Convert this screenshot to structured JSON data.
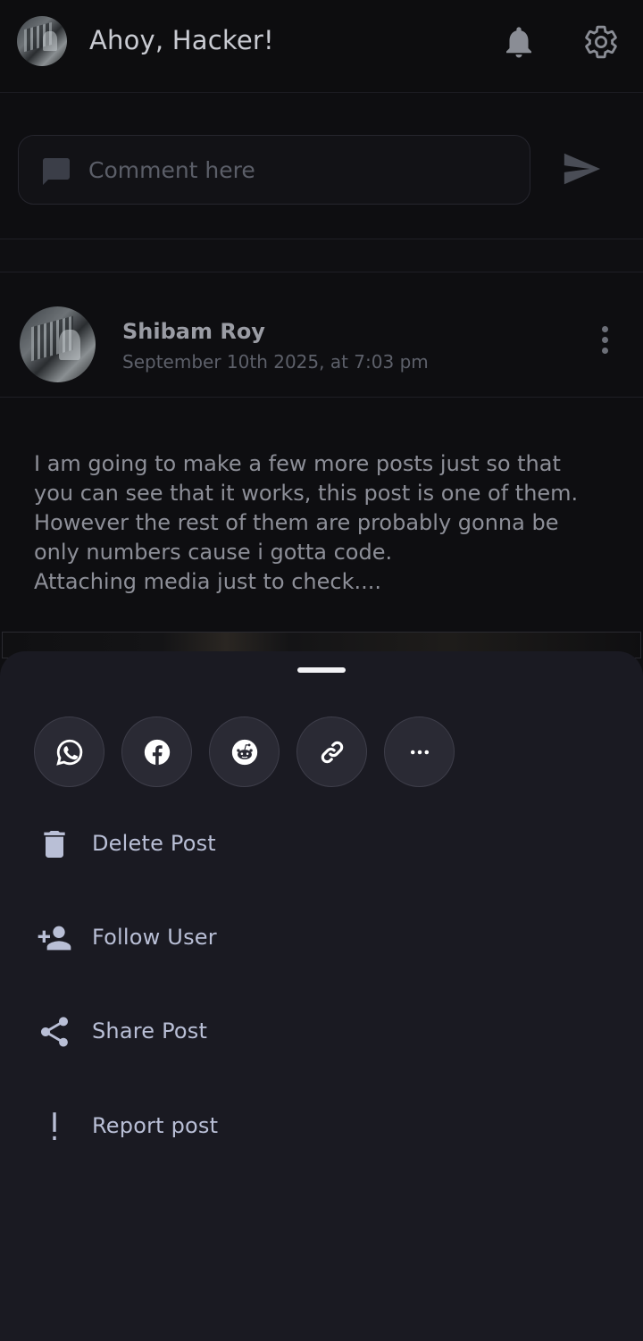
{
  "header": {
    "greeting": "Ahoy, Hacker!",
    "icons": [
      "profile-avatar",
      "bell-icon",
      "gear-icon"
    ]
  },
  "comment": {
    "placeholder": "Comment here",
    "icons": [
      "chat-bubble-icon",
      "send-icon"
    ]
  },
  "post": {
    "author": "Shibam Roy",
    "date": "September 10th 2025, at 7:03 pm",
    "body_lines": [
      "I am going to make a few more posts just so that",
      "you can see that it works, this post is one of them.",
      "However the rest of them are probably gonna be",
      "only numbers cause i gotta code.",
      "Attaching media just to check...."
    ]
  },
  "sheet": {
    "share_buttons": [
      "whatsapp-icon",
      "facebook-icon",
      "reddit-icon",
      "link-icon",
      "more-icon"
    ],
    "menu": [
      {
        "label": "Delete Post",
        "icon": "trash-icon"
      },
      {
        "label": "Follow User",
        "icon": "person-add-icon"
      },
      {
        "label": "Share Post",
        "icon": "share-icon"
      },
      {
        "label": "Report post",
        "icon": "exclamation-icon"
      }
    ]
  },
  "colors": {
    "background": "#0f0f12",
    "sheet": "#1a1a22",
    "menu_text": "#b9bfd6",
    "share_button": "#2a2a34"
  }
}
